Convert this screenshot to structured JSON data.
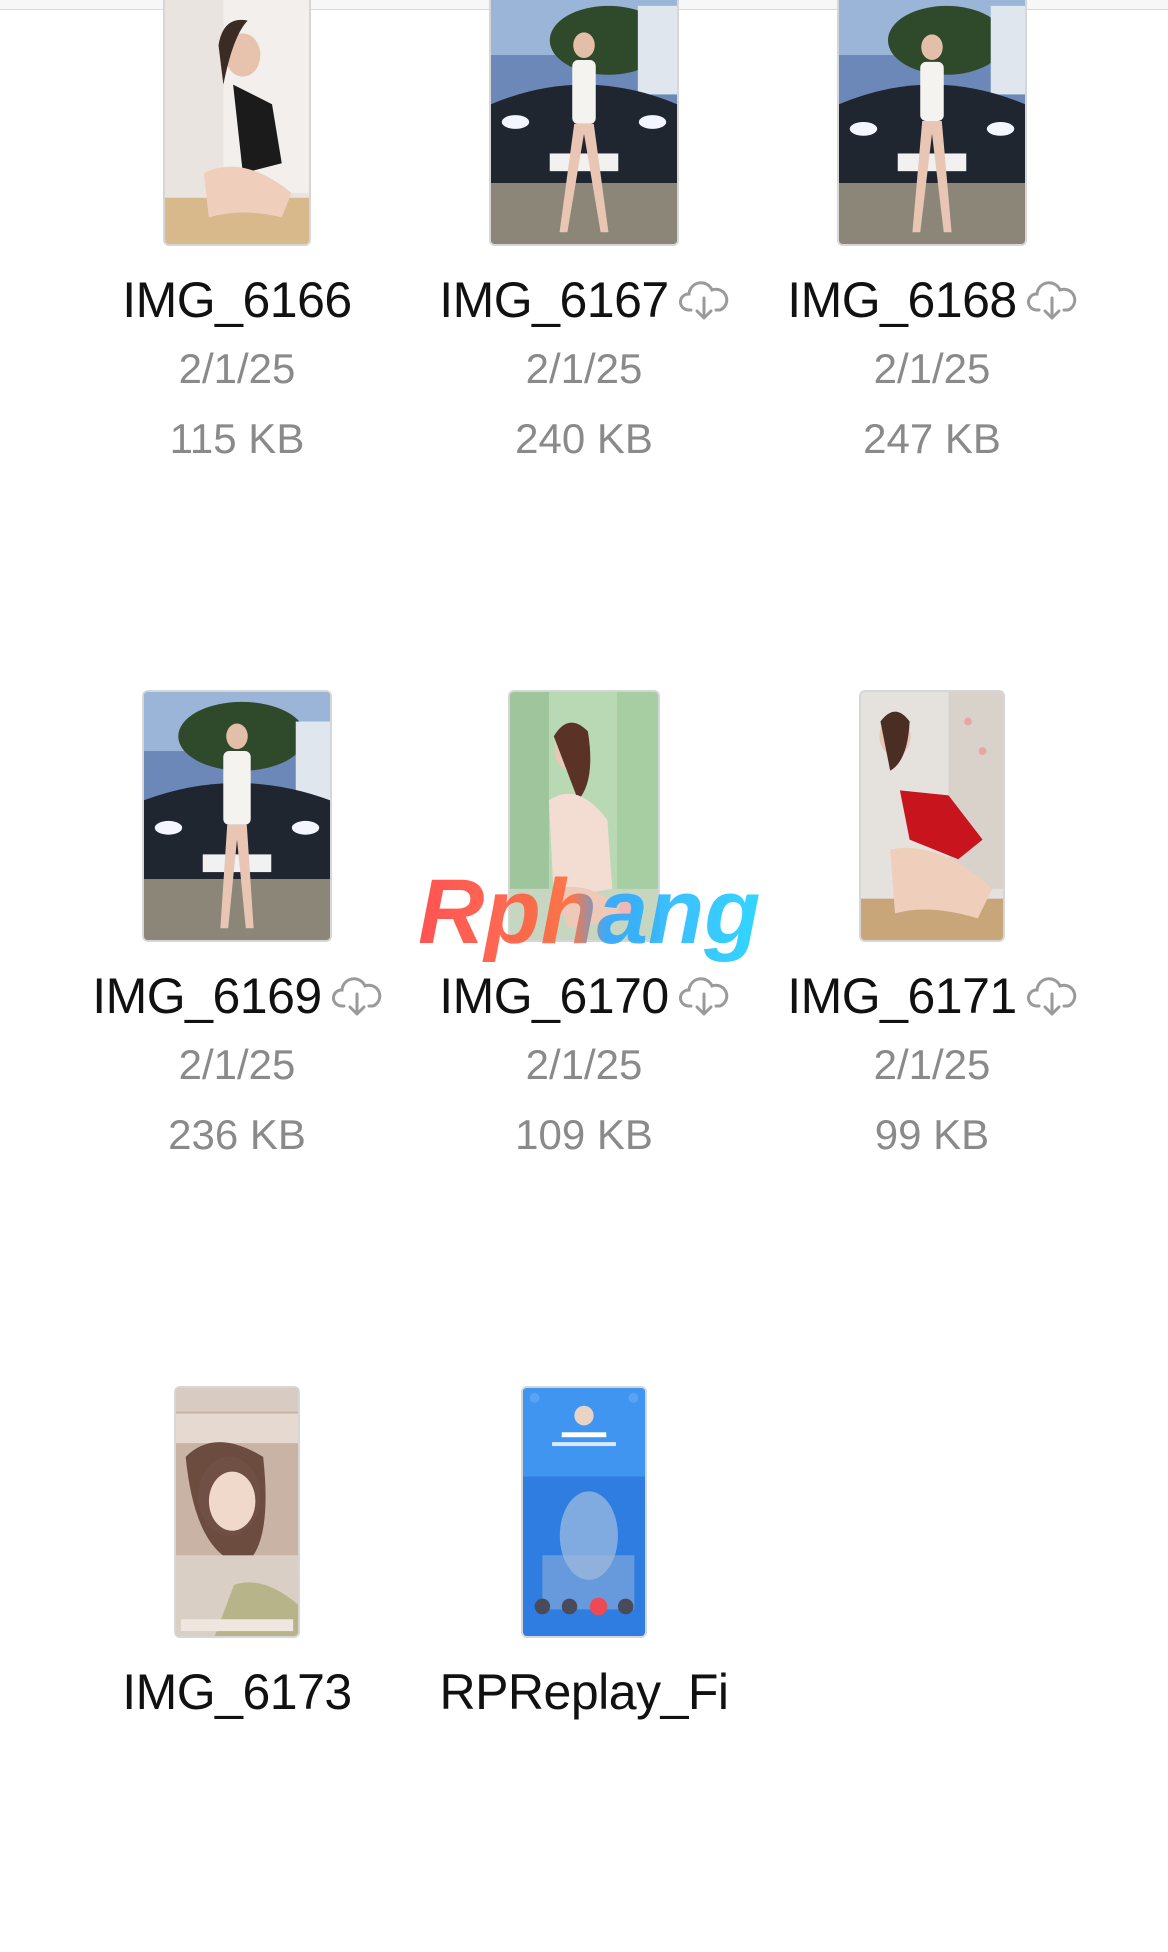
{
  "files": [
    {
      "name": "IMG_6166",
      "date": "2/1/25",
      "size": "115 KB",
      "cloud": false
    },
    {
      "name": "IMG_6167",
      "date": "2/1/25",
      "size": "240 KB",
      "cloud": true
    },
    {
      "name": "IMG_6168",
      "date": "2/1/25",
      "size": "247 KB",
      "cloud": true
    },
    {
      "name": "IMG_6169",
      "date": "2/1/25",
      "size": "236 KB",
      "cloud": true
    },
    {
      "name": "IMG_6170",
      "date": "2/1/25",
      "size": "109 KB",
      "cloud": true
    },
    {
      "name": "IMG_6171",
      "date": "2/1/25",
      "size": "99 KB",
      "cloud": true
    },
    {
      "name": "IMG_6173",
      "date": "",
      "size": "",
      "cloud": false
    },
    {
      "name": "RPReplay_Fi",
      "date": "",
      "size": "",
      "cloud": false
    }
  ],
  "watermark": {
    "text": "Rphang"
  },
  "icons": {
    "download": "cloud-download-icon"
  },
  "colors": {
    "text": "#111111",
    "meta": "#8a8a8a",
    "icon": "#9a9a9a"
  }
}
